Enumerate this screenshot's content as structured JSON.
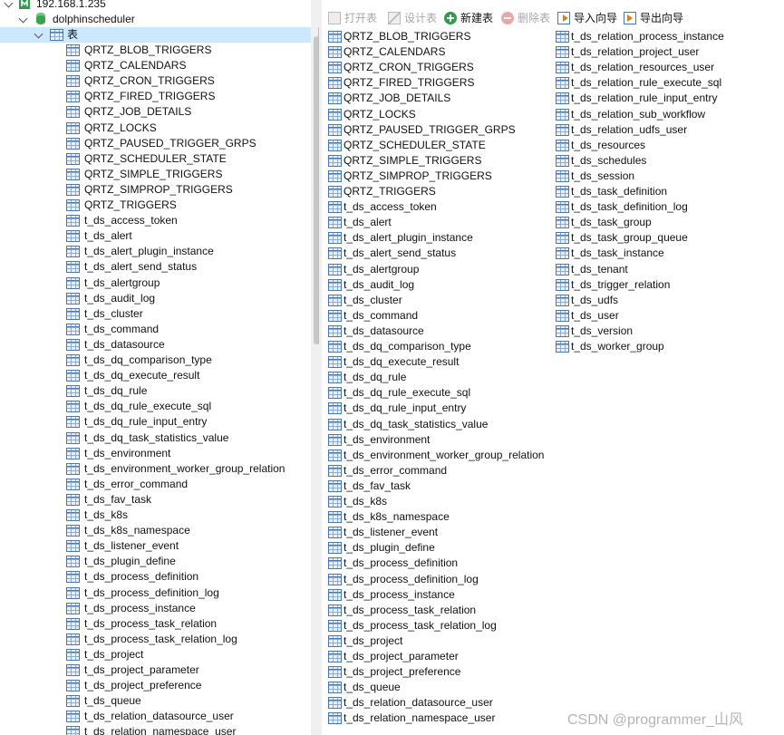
{
  "tree": {
    "connection": "192.168.1.235",
    "database": "dolphinscheduler",
    "category": "表",
    "tables": [
      "QRTZ_BLOB_TRIGGERS",
      "QRTZ_CALENDARS",
      "QRTZ_CRON_TRIGGERS",
      "QRTZ_FIRED_TRIGGERS",
      "QRTZ_JOB_DETAILS",
      "QRTZ_LOCKS",
      "QRTZ_PAUSED_TRIGGER_GRPS",
      "QRTZ_SCHEDULER_STATE",
      "QRTZ_SIMPLE_TRIGGERS",
      "QRTZ_SIMPROP_TRIGGERS",
      "QRTZ_TRIGGERS",
      "t_ds_access_token",
      "t_ds_alert",
      "t_ds_alert_plugin_instance",
      "t_ds_alert_send_status",
      "t_ds_alertgroup",
      "t_ds_audit_log",
      "t_ds_cluster",
      "t_ds_command",
      "t_ds_datasource",
      "t_ds_dq_comparison_type",
      "t_ds_dq_execute_result",
      "t_ds_dq_rule",
      "t_ds_dq_rule_execute_sql",
      "t_ds_dq_rule_input_entry",
      "t_ds_dq_task_statistics_value",
      "t_ds_environment",
      "t_ds_environment_worker_group_relation",
      "t_ds_error_command",
      "t_ds_fav_task",
      "t_ds_k8s",
      "t_ds_k8s_namespace",
      "t_ds_listener_event",
      "t_ds_plugin_define",
      "t_ds_process_definition",
      "t_ds_process_definition_log",
      "t_ds_process_instance",
      "t_ds_process_task_relation",
      "t_ds_process_task_relation_log",
      "t_ds_project",
      "t_ds_project_parameter",
      "t_ds_project_preference",
      "t_ds_queue",
      "t_ds_relation_datasource_user",
      "t_ds_relation_namespace_user"
    ]
  },
  "toolbar": {
    "open": "打开表",
    "design": "设计表",
    "new": "新建表",
    "delete": "删除表",
    "import": "导入向导",
    "export": "导出向导"
  },
  "objects": {
    "column1": [
      "QRTZ_BLOB_TRIGGERS",
      "QRTZ_CALENDARS",
      "QRTZ_CRON_TRIGGERS",
      "QRTZ_FIRED_TRIGGERS",
      "QRTZ_JOB_DETAILS",
      "QRTZ_LOCKS",
      "QRTZ_PAUSED_TRIGGER_GRPS",
      "QRTZ_SCHEDULER_STATE",
      "QRTZ_SIMPLE_TRIGGERS",
      "QRTZ_SIMPROP_TRIGGERS",
      "QRTZ_TRIGGERS",
      "t_ds_access_token",
      "t_ds_alert",
      "t_ds_alert_plugin_instance",
      "t_ds_alert_send_status",
      "t_ds_alertgroup",
      "t_ds_audit_log",
      "t_ds_cluster",
      "t_ds_command",
      "t_ds_datasource",
      "t_ds_dq_comparison_type",
      "t_ds_dq_execute_result",
      "t_ds_dq_rule",
      "t_ds_dq_rule_execute_sql",
      "t_ds_dq_rule_input_entry",
      "t_ds_dq_task_statistics_value",
      "t_ds_environment",
      "t_ds_environment_worker_group_relation",
      "t_ds_error_command",
      "t_ds_fav_task",
      "t_ds_k8s",
      "t_ds_k8s_namespace",
      "t_ds_listener_event",
      "t_ds_plugin_define",
      "t_ds_process_definition",
      "t_ds_process_definition_log",
      "t_ds_process_instance",
      "t_ds_process_task_relation",
      "t_ds_process_task_relation_log",
      "t_ds_project",
      "t_ds_project_parameter",
      "t_ds_project_preference",
      "t_ds_queue",
      "t_ds_relation_datasource_user",
      "t_ds_relation_namespace_user"
    ],
    "column2": [
      "t_ds_relation_process_instance",
      "t_ds_relation_project_user",
      "t_ds_relation_resources_user",
      "t_ds_relation_rule_execute_sql",
      "t_ds_relation_rule_input_entry",
      "t_ds_relation_sub_workflow",
      "t_ds_relation_udfs_user",
      "t_ds_resources",
      "t_ds_schedules",
      "t_ds_session",
      "t_ds_task_definition",
      "t_ds_task_definition_log",
      "t_ds_task_group",
      "t_ds_task_group_queue",
      "t_ds_task_instance",
      "t_ds_tenant",
      "t_ds_trigger_relation",
      "t_ds_udfs",
      "t_ds_user",
      "t_ds_version",
      "t_ds_worker_group"
    ]
  },
  "watermark": "CSDN @programmer_山风"
}
